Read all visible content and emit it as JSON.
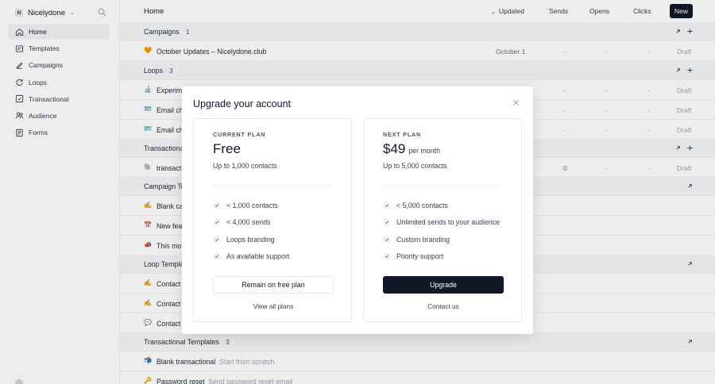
{
  "colors": {
    "accent": "#111827",
    "overlay": "rgba(0,0,0,0.07)",
    "muted": "#9ca3af"
  },
  "sidebar": {
    "workspace_initial": "N",
    "workspace_name": "Nicelydone",
    "items": [
      {
        "label": "Home",
        "icon": "home-icon",
        "active": true
      },
      {
        "label": "Templates",
        "icon": "templates-icon"
      },
      {
        "label": "Campaigns",
        "icon": "campaigns-icon"
      },
      {
        "label": "Loops",
        "icon": "loops-icon"
      },
      {
        "label": "Transactional",
        "icon": "transactional-icon"
      },
      {
        "label": "Audience",
        "icon": "audience-icon"
      },
      {
        "label": "Forms",
        "icon": "forms-icon"
      }
    ]
  },
  "header": {
    "title": "Home",
    "columns": {
      "updated": "Updated",
      "sends": "Sends",
      "opens": "Opens",
      "clicks": "Clicks"
    },
    "new_label": "New"
  },
  "sections": {
    "campaigns": {
      "title": "Campaigns",
      "count": "1"
    },
    "loops": {
      "title": "Loops",
      "count": "3"
    },
    "transactional": {
      "title": "Transactional",
      "count": ""
    },
    "campaign_templates": {
      "title": "Campaign Templates",
      "count": ""
    },
    "loop_templates": {
      "title": "Loop Templates",
      "count": ""
    },
    "transactional_templates": {
      "title": "Transactional Templates",
      "count": "3"
    }
  },
  "rows": {
    "campaign_1": {
      "emoji": "🧡",
      "name": "October Updates – Nicelydone.club",
      "updated": "October 1",
      "sends": "-",
      "opens": "-",
      "clicks": "-",
      "status": "Draft"
    },
    "loop_1": {
      "emoji": "🔬",
      "name": "Experim",
      "sends": "-",
      "opens": "-",
      "clicks": "-",
      "status": "Draft"
    },
    "loop_2": {
      "emoji": "🪪",
      "name": "Email ch",
      "sends": "-",
      "opens": "-",
      "clicks": "-",
      "status": "Draft"
    },
    "loop_3": {
      "emoji": "🪪",
      "name": "Email ch",
      "sends": "-",
      "opens": "-",
      "clicks": "-",
      "status": "Draft"
    },
    "tx_1": {
      "emoji": "🐘",
      "name": "transact",
      "sends": "0",
      "opens": "-",
      "clicks": "-",
      "status": "Draft"
    },
    "ct_1": {
      "emoji": "✍️",
      "name": "Blank ca"
    },
    "ct_2": {
      "emoji": "📅",
      "name": "New feat"
    },
    "ct_3": {
      "emoji": "📣",
      "name": "This mo"
    },
    "lt_1": {
      "emoji": "✍️",
      "name": "Contact"
    },
    "lt_2": {
      "emoji": "✍️",
      "name": "Contact"
    },
    "lt_3": {
      "emoji": "💬",
      "name": "Contact"
    },
    "tt_1": {
      "emoji": "📬",
      "name": "Blank transactional",
      "sub": "Start from scratch"
    },
    "tt_2": {
      "emoji": "🔑",
      "name": "Password reset",
      "sub": "Send password reset email"
    }
  },
  "modal": {
    "title": "Upgrade your account",
    "current": {
      "label": "CURRENT PLAN",
      "price": "Free",
      "contacts": "Up to 1,000 contacts",
      "features": [
        "< 1,000 contacts",
        "< 4,000 sends",
        "Loops branding",
        "As available support"
      ],
      "button": "Remain on free plan",
      "link": "View all plans"
    },
    "next": {
      "label": "NEXT PLAN",
      "price": "$49",
      "period": "per month",
      "contacts": "Up to 5,000 contacts",
      "features": [
        "< 5,000 contacts",
        "Unlimited sends to your audience",
        "Custom branding",
        "Priority support"
      ],
      "button": "Upgrade",
      "link": "Contact us"
    }
  }
}
